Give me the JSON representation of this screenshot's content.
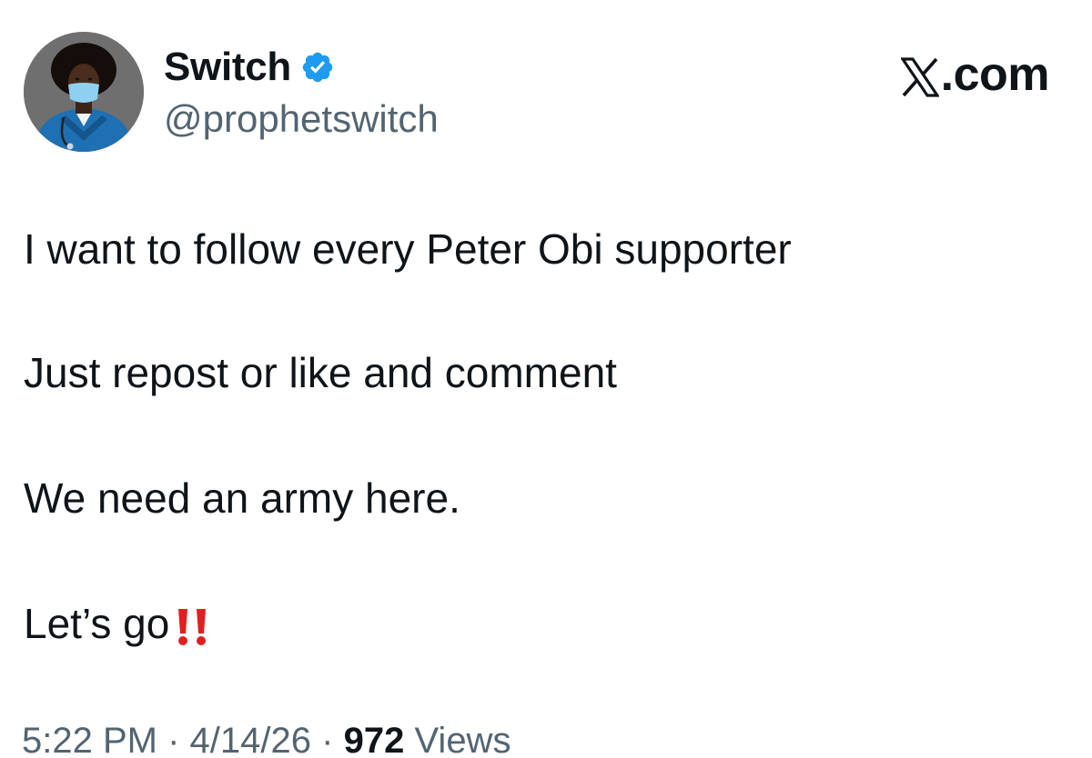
{
  "author": {
    "display_name": "Switch",
    "handle": "@prophetswitch",
    "verified": true,
    "verified_color": "#1d9bf0",
    "avatar_icon": "avatar-person-blue-scrubs"
  },
  "brand": {
    "label": ".com",
    "icon": "x-logo-icon"
  },
  "post": {
    "lines": [
      "I want to follow every Peter Obi supporter",
      "Just repost or like and comment",
      "We need an army here.",
      "Let’s go"
    ],
    "emoji": "double-exclamation-icon",
    "emoji_color": "#e0201e"
  },
  "meta": {
    "time": "5:22 PM",
    "separator": "·",
    "date": "4/14/26",
    "views_count": "972",
    "views_label": "Views"
  }
}
